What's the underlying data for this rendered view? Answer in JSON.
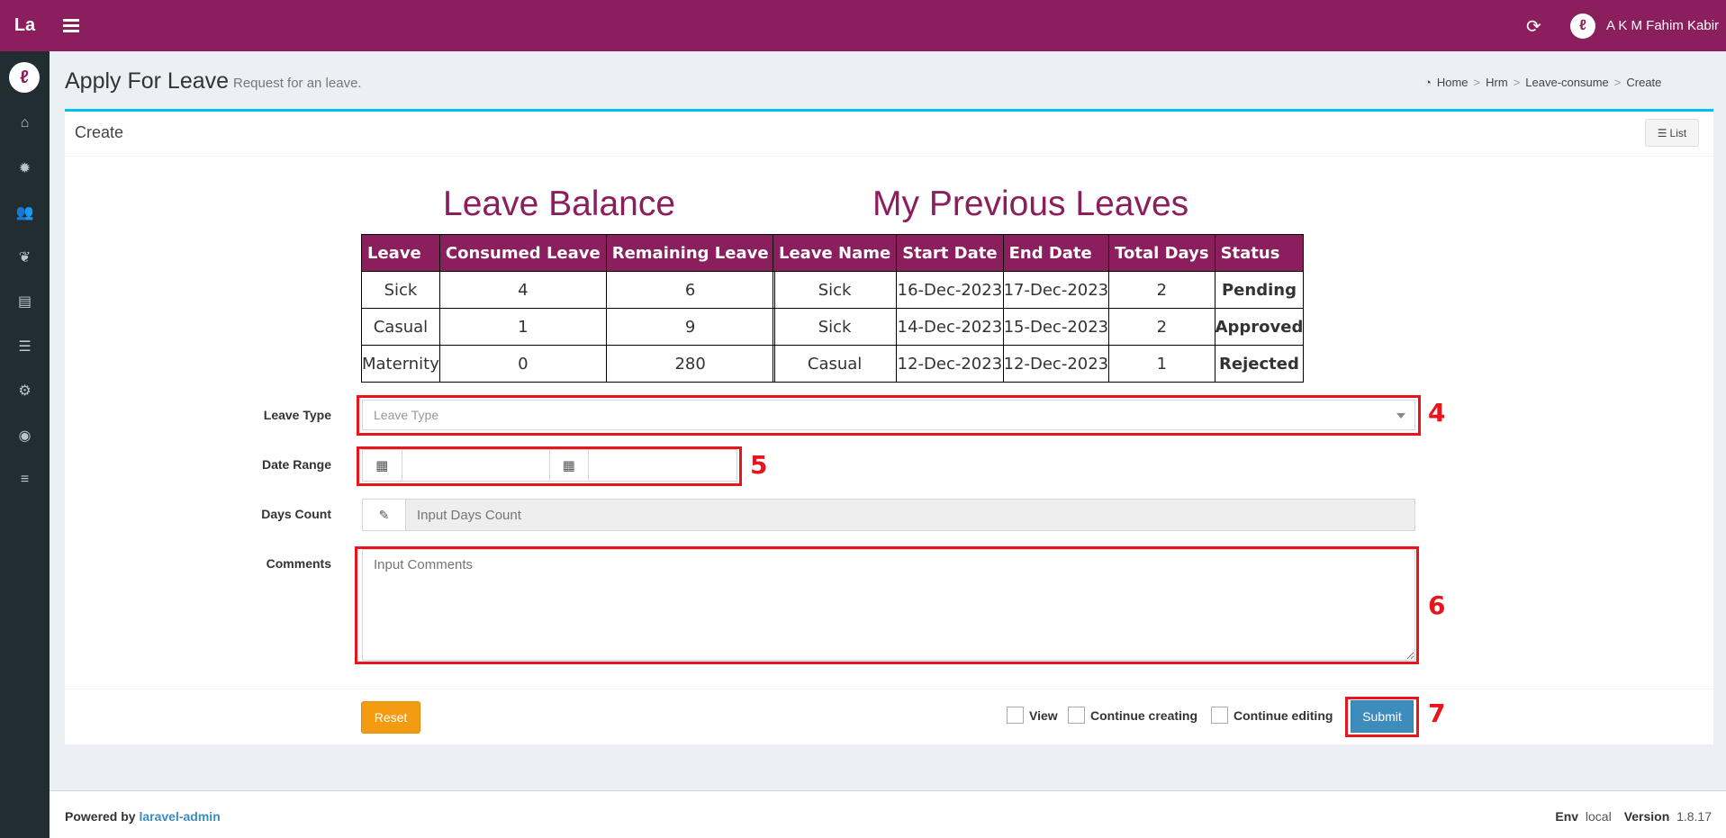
{
  "topbar": {
    "logo": "La",
    "user_name": "A K M Fahim Kabir",
    "colors": {
      "brand": "#8b1e5c",
      "sidebar": "#222d32"
    }
  },
  "sidebar": {
    "icons": [
      "home-icon",
      "gear-icon",
      "users-icon",
      "leaf-icon",
      "id-card-icon",
      "server-icon",
      "cogs-icon",
      "toggle-icon",
      "database-icon"
    ]
  },
  "header": {
    "title": "Apply For Leave",
    "subtitle": "Request for an leave.",
    "breadcrumb": [
      "Home",
      "Hrm",
      "Leave-consume",
      "Create"
    ]
  },
  "box": {
    "title": "Create",
    "list_label": "List"
  },
  "leave_balance": {
    "title": "Leave Balance",
    "headers": [
      "Leave",
      "Consumed Leave",
      "Remaining Leave"
    ],
    "rows": [
      [
        "Sick",
        "4",
        "6"
      ],
      [
        "Casual",
        "1",
        "9"
      ],
      [
        "Maternity",
        "0",
        "280"
      ]
    ]
  },
  "previous_leaves": {
    "title": "My Previous Leaves",
    "headers": [
      "Leave Name",
      "Start Date",
      "End Date",
      "Total Days",
      "Status"
    ],
    "rows": [
      [
        "Sick",
        "16-Dec-2023",
        "17-Dec-2023",
        "2",
        "Pending"
      ],
      [
        "Sick",
        "14-Dec-2023",
        "15-Dec-2023",
        "2",
        "Approved"
      ],
      [
        "Casual",
        "12-Dec-2023",
        "12-Dec-2023",
        "1",
        "Rejected"
      ]
    ]
  },
  "form": {
    "leave_type_label": "Leave Type",
    "leave_type_placeholder": "Leave Type",
    "date_range_label": "Date Range",
    "days_count_label": "Days Count",
    "days_count_placeholder": "Input Days Count",
    "comments_label": "Comments",
    "comments_placeholder": "Input Comments"
  },
  "actions": {
    "reset": "Reset",
    "view": "View",
    "continue_creating": "Continue creating",
    "continue_editing": "Continue editing",
    "submit": "Submit"
  },
  "annotations": [
    "4",
    "5",
    "6",
    "7"
  ],
  "footer": {
    "powered_by": "Powered by",
    "powered_link": "laravel-admin",
    "env_label": "Env",
    "env_value": "local",
    "version_label": "Version",
    "version_value": "1.8.17"
  }
}
